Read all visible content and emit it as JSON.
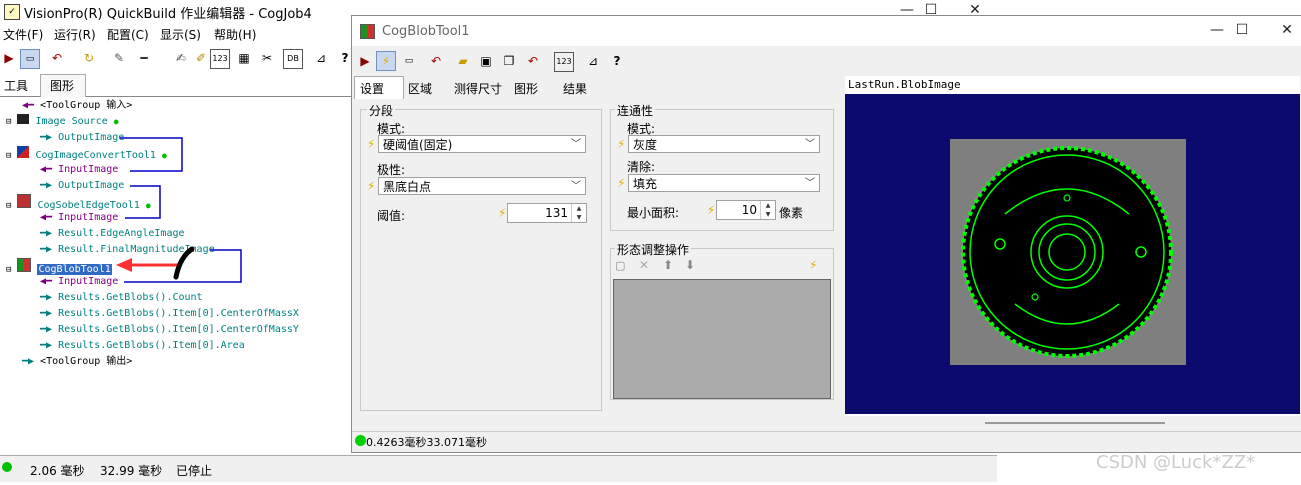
{
  "main_window": {
    "title": "VisionPro(R) QuickBuild 作业编辑器 - CogJob4",
    "min": "—",
    "max": "☐",
    "close": "✕"
  },
  "menu": [
    "文件(F)",
    "运行(R)",
    "配置(C)",
    "显示(S)",
    "帮助(H)"
  ],
  "left_tabs": [
    "工具",
    "图形"
  ],
  "tree": {
    "input_group": "<ToolGroup 输入>",
    "image_source": "Image Source",
    "output_image1": "OutputImage",
    "convert_tool": "CogImageConvertTool1",
    "input_image1": "InputImage",
    "output_image2": "OutputImage",
    "sobel_tool": "CogSobelEdgeTool1",
    "input_image2": "InputImage",
    "edge_angle": "Result.EdgeAngleImage",
    "final_magnitude": "Result.FinalMagnitudeImage",
    "blob_tool": "CogBlobTool1",
    "input_image3": "InputImage",
    "blobs_count": "Results.GetBlobs().Count",
    "center_x": "Results.GetBlobs().Item[0].CenterOfMassX",
    "center_y": "Results.GetBlobs().Item[0].CenterOfMassY",
    "area": "Results.GetBlobs().Item[0].Area",
    "output_group": "<ToolGroup 输出>"
  },
  "status": {
    "time1": "2.06 毫秒",
    "time2": "32.99 毫秒",
    "state": "已停止"
  },
  "dialog": {
    "title": "CogBlobTool1",
    "min": "—",
    "max": "☐",
    "close": "✕",
    "tabs": [
      "设置",
      "区域",
      "测得尺寸",
      "图形",
      "结果"
    ],
    "segment": {
      "group_label": "分段",
      "mode_label": "模式:",
      "mode_value": "硬阈值(固定)",
      "polarity_label": "极性:",
      "polarity_value": "黑底白点",
      "threshold_label": "阈值:",
      "threshold_value": "131"
    },
    "connectivity": {
      "group_label": "连通性",
      "mode_label": "模式:",
      "mode_value": "灰度",
      "clear_label": "清除:",
      "clear_value": "填充",
      "min_area_label": "最小面积:",
      "min_area_value": "10",
      "min_area_unit": "像素"
    },
    "morph": {
      "group_label": "形态调整操作"
    },
    "image_label": "LastRun.BlobImage",
    "status_text": "0.4263毫秒33.071毫秒"
  },
  "watermark": "CSDN @Luck*ZZ*",
  "colors": {
    "tree_cyan": "#008080",
    "tree_purple": "#800080",
    "link_blue": "#0000cc",
    "image_bg": "#0b0b6e",
    "blob_green": "#00ff00",
    "annotation_red": "#ff3030"
  }
}
